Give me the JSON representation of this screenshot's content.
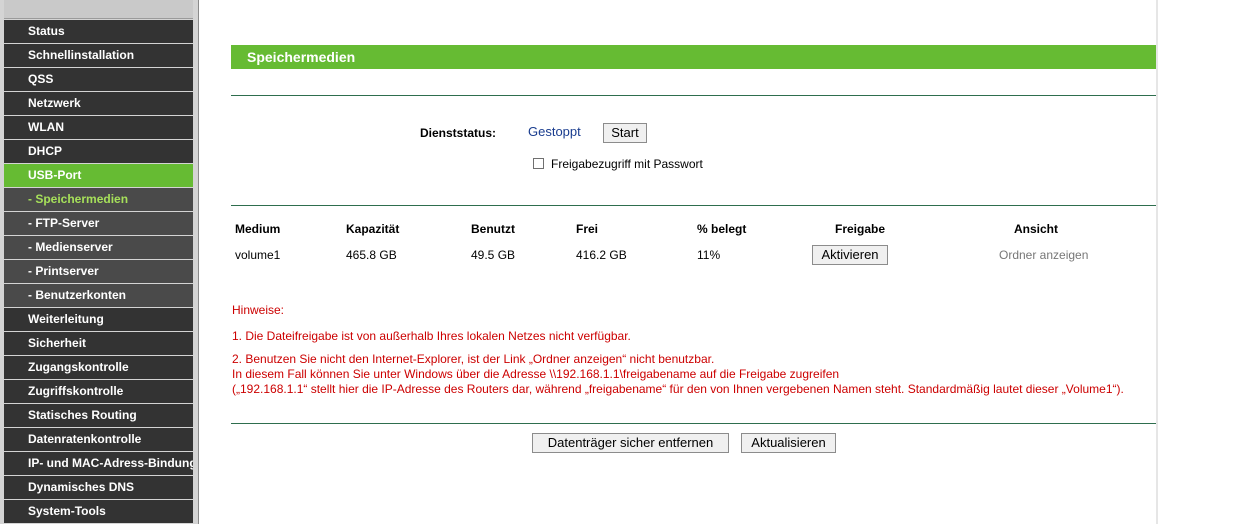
{
  "sidebar": {
    "items": [
      {
        "label": "Status"
      },
      {
        "label": "Schnellinstallation"
      },
      {
        "label": "QSS"
      },
      {
        "label": "Netzwerk"
      },
      {
        "label": "WLAN"
      },
      {
        "label": "DHCP"
      },
      {
        "label": "USB-Port"
      },
      {
        "label": "- Speichermedien"
      },
      {
        "label": "- FTP-Server"
      },
      {
        "label": "- Medienserver"
      },
      {
        "label": "- Printserver"
      },
      {
        "label": "- Benutzerkonten"
      },
      {
        "label": "Weiterleitung"
      },
      {
        "label": "Sicherheit"
      },
      {
        "label": "Zugangskontrolle"
      },
      {
        "label": "Zugriffskontrolle"
      },
      {
        "label": "Statisches Routing"
      },
      {
        "label": "Datenratenkontrolle"
      },
      {
        "label": "IP- und MAC-Adress-Bindung"
      },
      {
        "label": "Dynamisches DNS"
      },
      {
        "label": "System-Tools"
      }
    ],
    "active_item": "USB-Port",
    "current_subitem": "- Speichermedien"
  },
  "page": {
    "title": "Speichermedien"
  },
  "service": {
    "status_label": "Dienststatus:",
    "status_value": "Gestoppt",
    "start_button": "Start",
    "password_checkbox_label": "Freigabezugriff mit Passwort",
    "password_checkbox_checked": false
  },
  "table": {
    "headers": [
      "Medium",
      "Kapazität",
      "Benutzt",
      "Frei",
      "% belegt",
      "Freigabe",
      "Ansicht"
    ],
    "rows": [
      {
        "medium": "volume1",
        "capacity": "465.8 GB",
        "used": "49.5 GB",
        "free": "416.2 GB",
        "percent_used": "11%",
        "share_button": "Aktivieren",
        "view_link": "Ordner anzeigen"
      }
    ]
  },
  "notes": {
    "heading": "Hinweise:",
    "line1": "1. Die Dateifreigabe ist von außerhalb Ihres lokalen Netzes nicht verfügbar.",
    "line2a": "2. Benutzen Sie nicht den Internet-Explorer, ist der Link „Ordner anzeigen“ nicht benutzbar.",
    "line2b": "In diesem Fall können Sie unter Windows über die Adresse \\\\192.168.1.1\\freigabename auf die Freigabe zugreifen",
    "line2c": "(„192.168.1.1“ stellt hier die IP-Adresse des Routers dar, während „freigabename“ für den von Ihnen vergebenen Namen steht. Standardmäßig lautet dieser „Volume1“)."
  },
  "footer": {
    "eject_button": "Datenträger sicher entfernen",
    "refresh_button": "Aktualisieren"
  },
  "colors": {
    "accent_green": "#66bb33",
    "menu_dark": "#333333",
    "status_blue": "#1a3d8f",
    "note_red": "#cc0000"
  }
}
